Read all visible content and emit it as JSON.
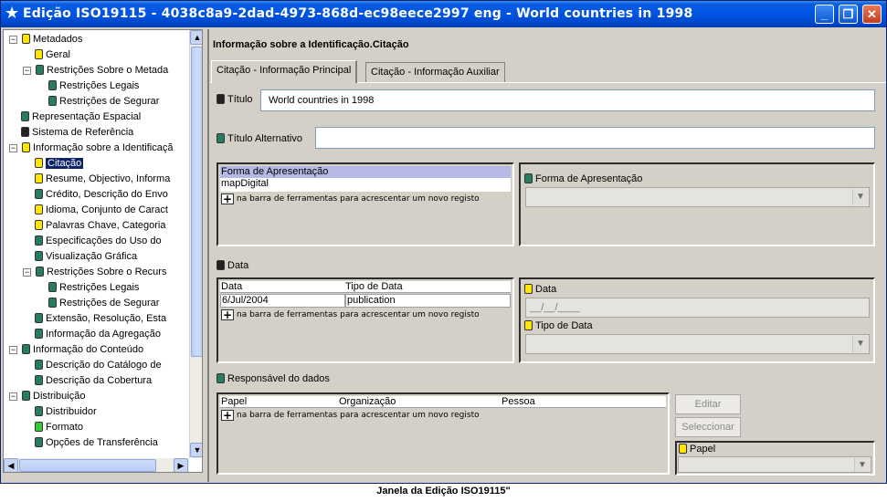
{
  "window": {
    "star": "★",
    "title": "Edição ISO19115 - 4038c8a9-2dad-4973-868d-ec98eece2997 eng - World countries in 1998",
    "minimize": "_",
    "maximize": "❐",
    "close": "✕"
  },
  "tree": {
    "items": [
      {
        "label": "Metadados",
        "color": "yellow",
        "expander": "−"
      },
      {
        "label": "Geral",
        "color": "yellow"
      },
      {
        "label": "Restrições Sobre o Metada",
        "color": "teal",
        "expander": "−"
      },
      {
        "label": "Restrições Legais",
        "color": "teal"
      },
      {
        "label": "Restrições de Segurar",
        "color": "teal"
      },
      {
        "label": "Representação Espacial",
        "color": "teal"
      },
      {
        "label": "Sistema de Referência",
        "color": "black"
      },
      {
        "label": "Informação sobre a Identificaçã",
        "color": "yellow",
        "expander": "−"
      },
      {
        "label": "Citação",
        "color": "yellow"
      },
      {
        "label": "Resume, Objectivo, Informa",
        "color": "yellow"
      },
      {
        "label": "Crédito, Descrição do Envo",
        "color": "teal"
      },
      {
        "label": "Idioma, Conjunto de Caract",
        "color": "yellow"
      },
      {
        "label": "Palavras Chave, Categoria",
        "color": "yellow"
      },
      {
        "label": "Especificações do Uso do",
        "color": "teal"
      },
      {
        "label": "Visualização Gráfica",
        "color": "teal"
      },
      {
        "label": "Restrições Sobre o Recurs",
        "color": "teal",
        "expander": "−"
      },
      {
        "label": "Restrições Legais",
        "color": "teal"
      },
      {
        "label": "Restrições de Segurar",
        "color": "teal"
      },
      {
        "label": "Extensão, Resolução, Esta",
        "color": "teal"
      },
      {
        "label": "Informação da Agregação",
        "color": "teal"
      },
      {
        "label": "Informação do Conteúdo",
        "color": "teal",
        "expander": "−"
      },
      {
        "label": "Descrição do Catálogo de",
        "color": "teal"
      },
      {
        "label": "Descrição da Cobertura",
        "color": "teal"
      },
      {
        "label": "Distribuição",
        "color": "teal",
        "expander": "−"
      },
      {
        "label": "Distribuidor",
        "color": "teal"
      },
      {
        "label": "Formato",
        "color": "green"
      },
      {
        "label": "Opções de Transferência",
        "color": "teal"
      }
    ],
    "selected_index": 8
  },
  "content": {
    "heading": "Informação sobre a Identificação.Citação",
    "tabs": [
      "Citação - Informação Principal",
      "Citação - Informação Auxiliar"
    ],
    "active_tab": 0,
    "titulo": {
      "label": "Título",
      "value": "World countries in 1998"
    },
    "titulo_alternativo": {
      "label": "Título Alternativo",
      "value": ""
    },
    "forma": {
      "column": "Forma de Apresentação",
      "rows": [
        "mapDigital"
      ],
      "detail_label": "Forma de Apresentação",
      "detail_value": ""
    },
    "add_hint": "na barra de ferramentas para acrescentar um novo registo",
    "data_section": {
      "label": "Data",
      "columns": [
        "Data",
        "Tipo de Data"
      ],
      "rows": [
        [
          "6/Jul/2004",
          "publication"
        ]
      ],
      "detail_date_label": "Data",
      "detail_date_value": "__/__/____",
      "detail_type_label": "Tipo de Data",
      "detail_type_value": ""
    },
    "responsavel": {
      "label": "Responsável do dados",
      "columns": [
        "Papel",
        "Organização",
        "Pessoa"
      ],
      "edit_button": "Editar",
      "select_button": "Seleccionar",
      "papel_label": "Papel",
      "papel_value": ""
    }
  },
  "caption": "Janela da Edição ISO19115\"",
  "colors": {
    "title_bar": "#0054e3",
    "selected": "#0a246a",
    "grid_header": "#b6b9e6"
  }
}
